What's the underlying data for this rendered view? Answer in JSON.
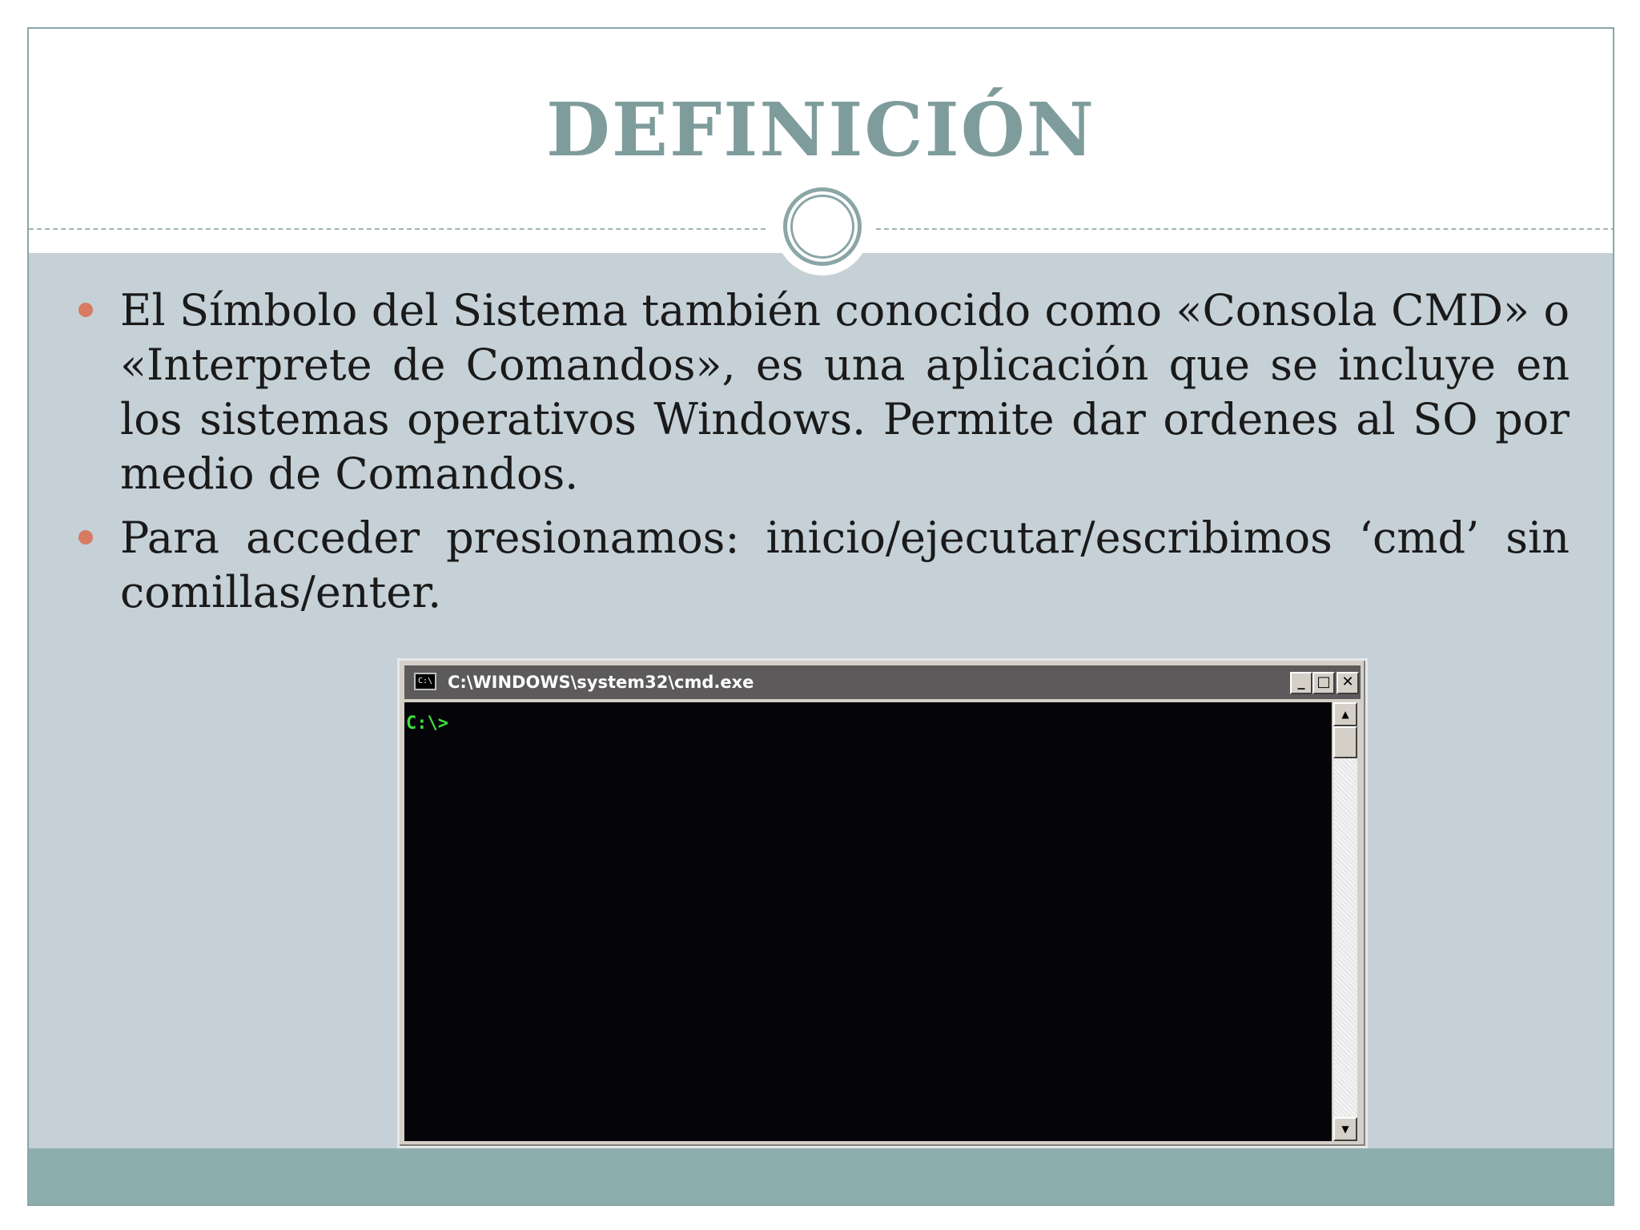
{
  "slide": {
    "title": "DEFINICIÓN",
    "bullets": [
      "El Símbolo del Sistema también conocido como «Consola CMD» o «Interprete de Comandos», es una aplicación que se incluye en los sistemas operativos Windows. Permite dar ordenes al SO por medio de Comandos.",
      "Para acceder presionamos: inicio/ejecutar/escribimos ‘cmd’ sin comillas/enter."
    ]
  },
  "cmd_window": {
    "icon_label": "C:\\",
    "title": "C:\\WINDOWS\\system32\\cmd.exe",
    "minimize_label": "_",
    "maximize_label": "□",
    "close_label": "✕",
    "prompt": "C:\\>",
    "scroll_up_label": "▲",
    "scroll_down_label": "▼"
  },
  "colors": {
    "title": "#7f9c9c",
    "body_background": "#c5d1d7",
    "footer_band": "#8daeae",
    "bullet": "#d77b62",
    "prompt_text": "#3fe03f"
  }
}
